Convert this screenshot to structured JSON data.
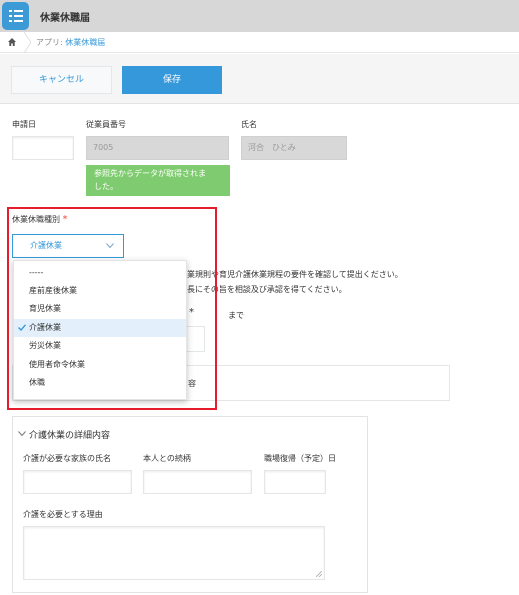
{
  "header": {
    "title": "休業休職届",
    "icon": "app-list-icon",
    "color": "#3c9ad6"
  },
  "breadcrumb": {
    "prefix": "アプリ: ",
    "link": "休業休職届",
    "icon": "home-icon"
  },
  "toolbar": {
    "cancel_label": "キャンセル",
    "save_label": "保存",
    "accent": "#3498db"
  },
  "form": {
    "apply_date": {
      "label": "申請日",
      "value": ""
    },
    "employee_no": {
      "label": "従業員番号",
      "value": "7005"
    },
    "name": {
      "label": "氏名",
      "value": "河合　ひとみ"
    },
    "notice_line1": "参照先からデータが取得されま",
    "notice_line2": "した。",
    "leave_type": {
      "label": "休業休職種別",
      "required_mark": "*",
      "selected": "介護休業",
      "options": [
        "-----",
        "産前産後休業",
        "育児休業",
        "介護休業",
        "労災休業",
        "使用者命令休業",
        "休職"
      ]
    },
    "bg_text_line1": "業規則や育児介護休業規程の要件を確認して提出ください。",
    "bg_text_line2": "長にその旨を相談及び承認を得てください。",
    "bg_required_mark": "*",
    "bg_until": "まで",
    "bg_section_tail": "容"
  },
  "detail": {
    "title": "介護休業の詳細内容",
    "family_name_label": "介護が必要な家族の氏名",
    "relation_label": "本人との続柄",
    "return_date_label": "職場復帰（予定）日",
    "reason_label": "介護を必要とする理由"
  }
}
